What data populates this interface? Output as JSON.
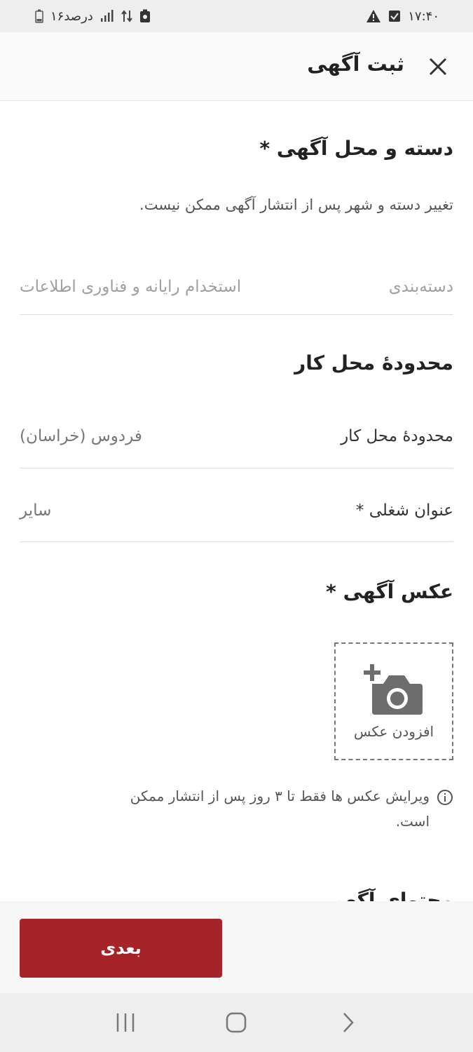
{
  "status_bar": {
    "time": "۱۷:۴۰",
    "battery_text": "۱۶درصد",
    "icons": [
      "warning-icon",
      "checkbox-icon",
      "signal-icon",
      "data-transfer-icon",
      "battery-icon"
    ]
  },
  "header": {
    "title": "ثبت آگهی",
    "close_icon": "close-icon"
  },
  "category_section": {
    "title": "دسته و محل آگهی *",
    "hint": "تغییر دسته و شهر پس از انتشار آگهی ممکن نیست.",
    "category_label": "دسته‌بندی",
    "category_value": "استخدام رایانه و فناوری اطلاعات"
  },
  "work_area_section": {
    "title": "محدودهٔ محل کار",
    "work_area_label": "محدودهٔ محل کار",
    "work_area_value": "فردوس (خراسان)",
    "job_title_label": "عنوان شغلی *",
    "job_title_value": "سایر"
  },
  "photo_section": {
    "title": "عکس آگهی *",
    "add_photo_label": "افزودن عکس",
    "info_text_line1": "ویرایش عکس ها فقط تا ۳ روز پس از انتشار ممکن",
    "info_text_line2": "است."
  },
  "cutoff_section": {
    "title": "محتوای آگهی"
  },
  "footer": {
    "next_label": "بعدی"
  },
  "colors": {
    "primary_button": "#a52427",
    "status_bar_bg": "#eeeeee",
    "app_bar_bg": "#fafafa"
  }
}
